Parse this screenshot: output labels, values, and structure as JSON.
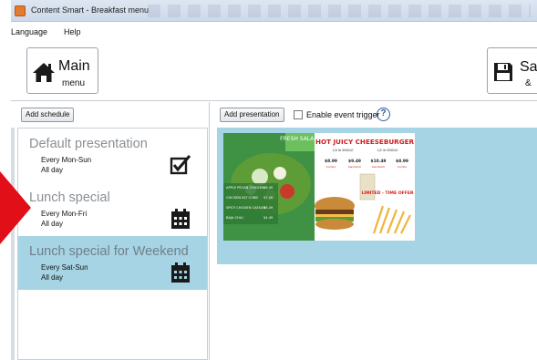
{
  "window": {
    "title": "Content Smart - Breakfast menu"
  },
  "menu": {
    "items": [
      "Language",
      "Help"
    ]
  },
  "toolbar": {
    "main_menu": {
      "line1": "Main",
      "line2": "menu"
    },
    "save": {
      "line1": "Sa",
      "line2": "&"
    }
  },
  "schedule": {
    "add_label": "Add schedule",
    "items": [
      {
        "title": "Default presentation",
        "days": "Every Mon-Sun",
        "time": "All day",
        "icon": "checkbox-icon",
        "selected": false
      },
      {
        "title": "Lunch special",
        "days": "Every Mon-Fri",
        "time": "All day",
        "icon": "calendar-icon",
        "selected": false
      },
      {
        "title": "Lunch special for Weekend",
        "days": "Every Sat-Sun",
        "time": "All day",
        "icon": "calendar-icon",
        "selected": true
      }
    ]
  },
  "presentation": {
    "add_label": "Add presentation",
    "event_trigger_label": "Enable event trigger",
    "event_trigger_checked": false,
    "help_label": "?",
    "thumbnail": {
      "left_header": "FRESH SALADS",
      "headline": "HOT JUICY CHEESEBURGER",
      "sizes": [
        "1/4 lb SINGLE",
        "1/2 lb SINGLE"
      ],
      "prices": [
        "$8.99",
        "$9.49",
        "$10.49",
        "$8.99"
      ],
      "combos": [
        "Combo",
        "Sandwich",
        "Sandwich",
        "Combo"
      ],
      "salad_items": [
        {
          "name": "APPLE PECAN CHICKEN",
          "price": "$8.49"
        },
        {
          "name": "CHICKEN BLT COBB",
          "price": "$7.49"
        },
        {
          "name": "SPICY CHICKEN CAESAR",
          "price": "$6.49"
        },
        {
          "name": "BAJA CHILI",
          "price": "$4.49"
        }
      ],
      "offer": "LIMITED - TIME OFFER"
    }
  },
  "colors": {
    "selected_bg": "#a7d4e4",
    "presentation_bg": "#a7d4e4",
    "accent_red": "#e10f17",
    "title_gray": "#8a8f95"
  }
}
